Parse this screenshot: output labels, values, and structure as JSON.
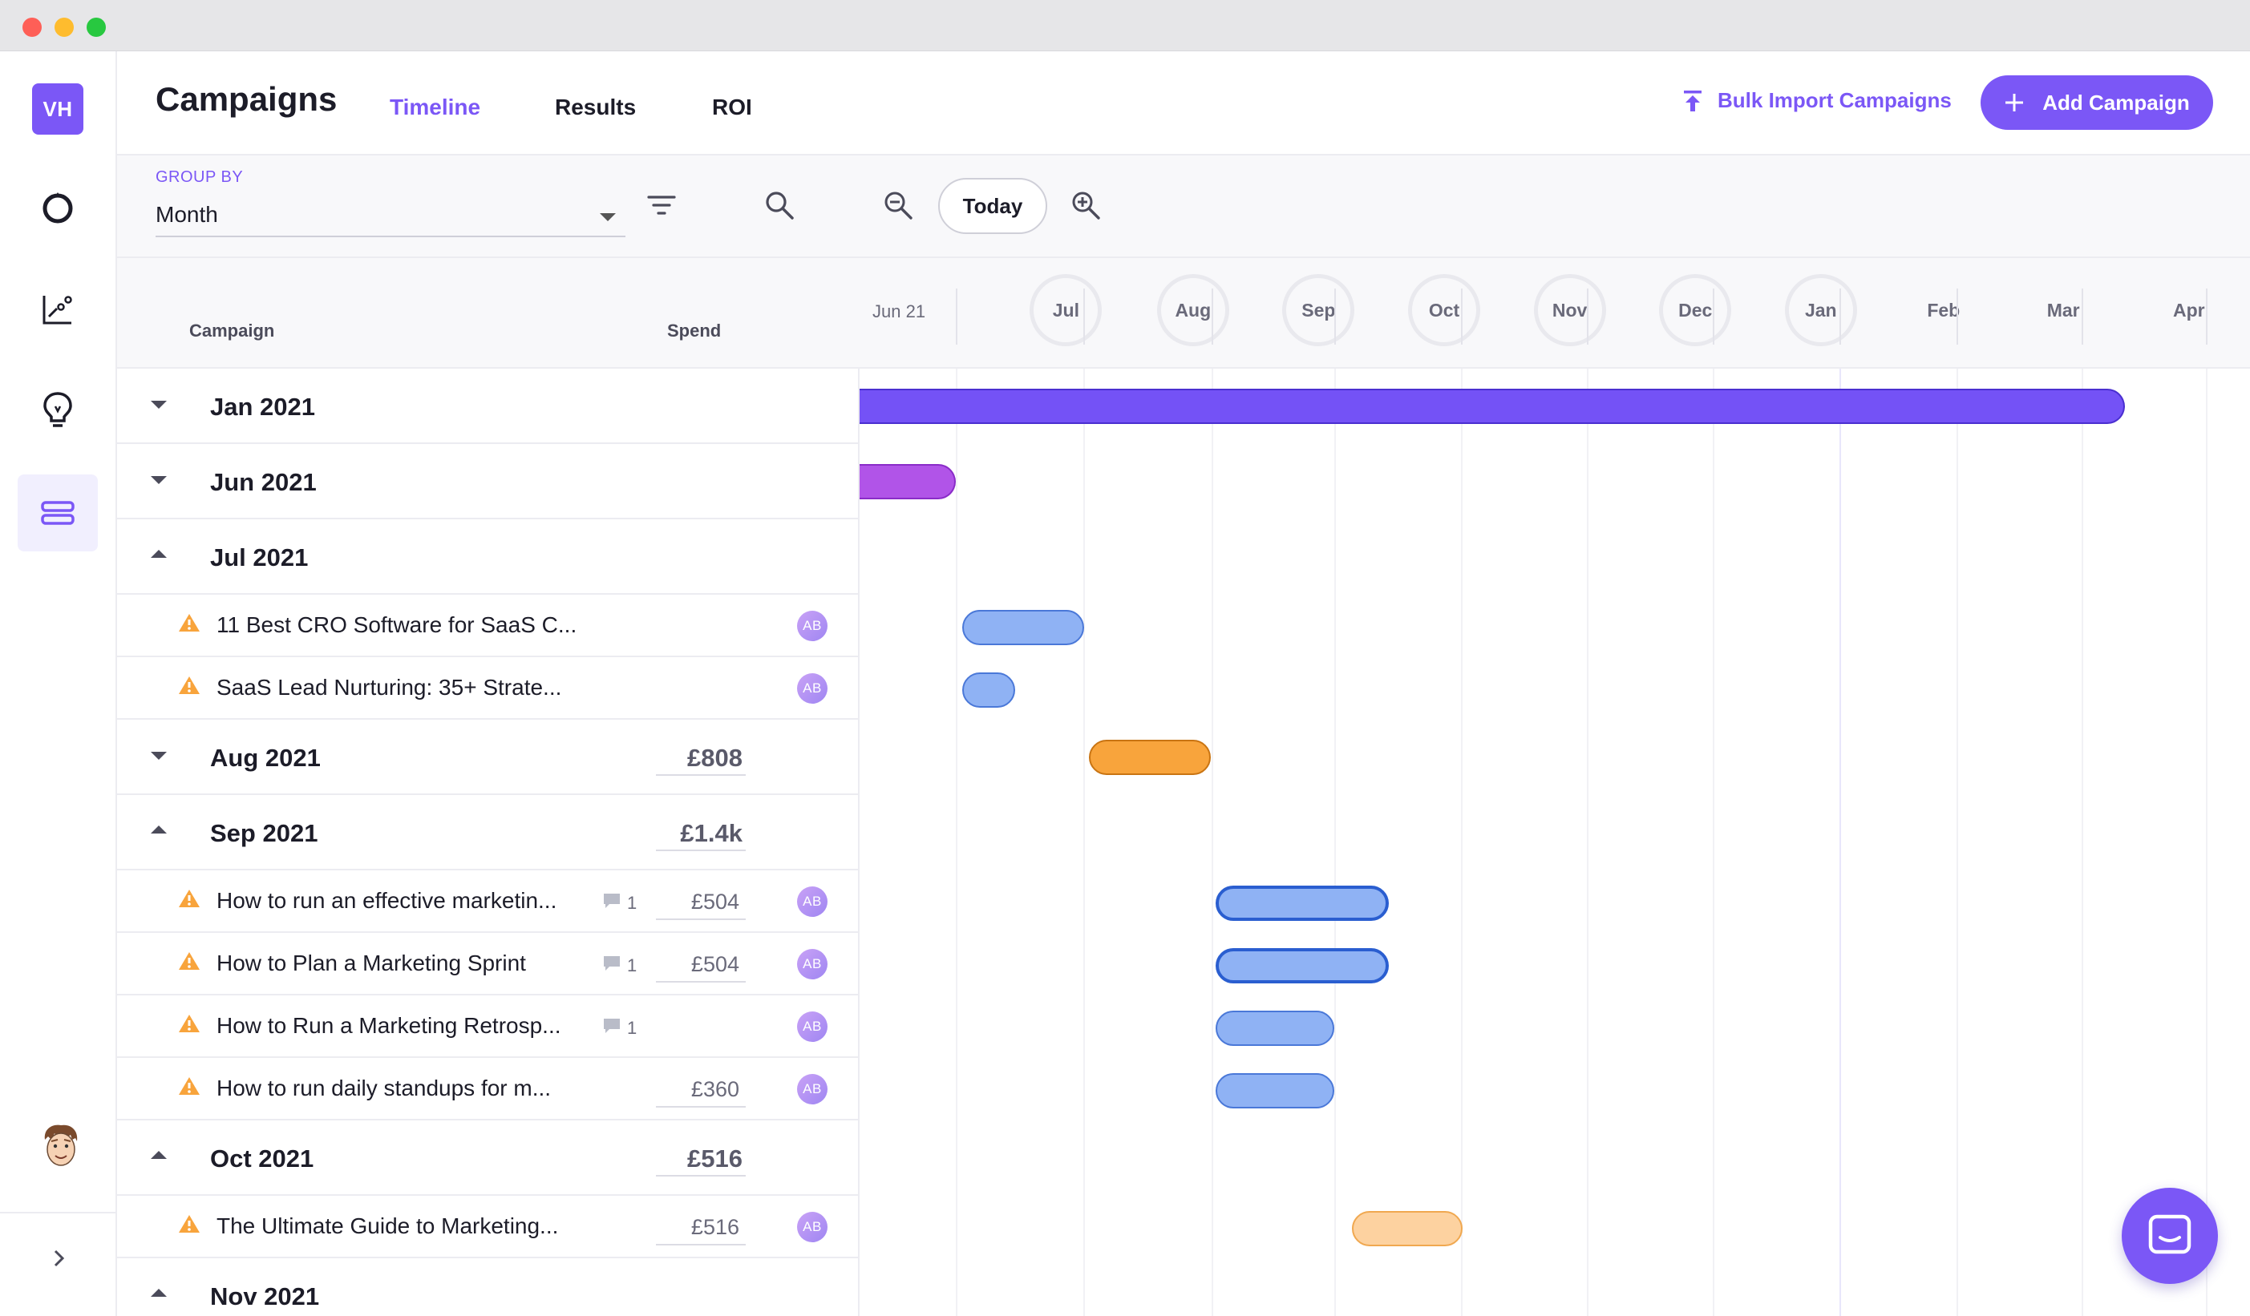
{
  "app": {
    "logo_initials": "VH",
    "title": "Campaigns",
    "tabs": [
      {
        "label": "Timeline",
        "active": true
      },
      {
        "label": "Results",
        "active": false
      },
      {
        "label": "ROI",
        "active": false
      }
    ],
    "bulk_import_label": "Bulk Import Campaigns",
    "add_campaign_label": "Add Campaign",
    "accent_color": "#7b57f6"
  },
  "sidebar": {
    "items": [
      {
        "icon": "focus-icon",
        "active": false
      },
      {
        "icon": "chart-icon",
        "active": false
      },
      {
        "icon": "lightbulb-icon",
        "active": false
      },
      {
        "icon": "timeline-icon",
        "active": true
      }
    ],
    "user_avatar": "user-avatar",
    "expand_icon": "chevron-right-icon"
  },
  "controls": {
    "group_by_label": "GROUP BY",
    "group_by_value": "Month",
    "today_label": "Today"
  },
  "columns": {
    "campaign": "Campaign",
    "spend": "Spend"
  },
  "timeline_months": [
    "Jun 21",
    "Jul",
    "Aug",
    "Sep",
    "Oct",
    "Nov",
    "Dec",
    "Jan",
    "Feb",
    "Mar",
    "Apr"
  ],
  "groups": [
    {
      "label": "Jan 2021",
      "expanded": false,
      "spend": "",
      "items": []
    },
    {
      "label": "Jun 2021",
      "expanded": false,
      "spend": "",
      "items": []
    },
    {
      "label": "Jul 2021",
      "expanded": true,
      "spend": "",
      "items": [
        {
          "name": "11 Best CRO Software for SaaS C...",
          "comments": "",
          "spend": "",
          "assignee": "AB"
        },
        {
          "name": "SaaS Lead Nurturing: 35+ Strate...",
          "comments": "",
          "spend": "",
          "assignee": "AB"
        }
      ]
    },
    {
      "label": "Aug 2021",
      "expanded": false,
      "spend": "£808",
      "items": []
    },
    {
      "label": "Sep 2021",
      "expanded": true,
      "spend": "£1.4k",
      "items": [
        {
          "name": "How to run an effective marketin...",
          "comments": "1",
          "spend": "£504",
          "assignee": "AB"
        },
        {
          "name": "How to Plan a Marketing Sprint",
          "comments": "1",
          "spend": "£504",
          "assignee": "AB"
        },
        {
          "name": "How to Run a Marketing Retrosp...",
          "comments": "1",
          "spend": "",
          "assignee": "AB"
        },
        {
          "name": "How to run daily standups for m...",
          "comments": "",
          "spend": "£360",
          "assignee": "AB"
        }
      ]
    },
    {
      "label": "Oct 2021",
      "expanded": true,
      "spend": "£516",
      "items": [
        {
          "name": "The Ultimate Guide to Marketing...",
          "comments": "",
          "spend": "£516",
          "assignee": "AB"
        }
      ]
    },
    {
      "label": "Nov 2021",
      "expanded": true,
      "spend": "",
      "items": []
    }
  ],
  "bar_colors": {
    "purple": "#7452f6",
    "magenta": "#b154e8",
    "blue": "#8fb2f4",
    "orange": "#f8a43c",
    "peach": "#fdd2a0"
  }
}
